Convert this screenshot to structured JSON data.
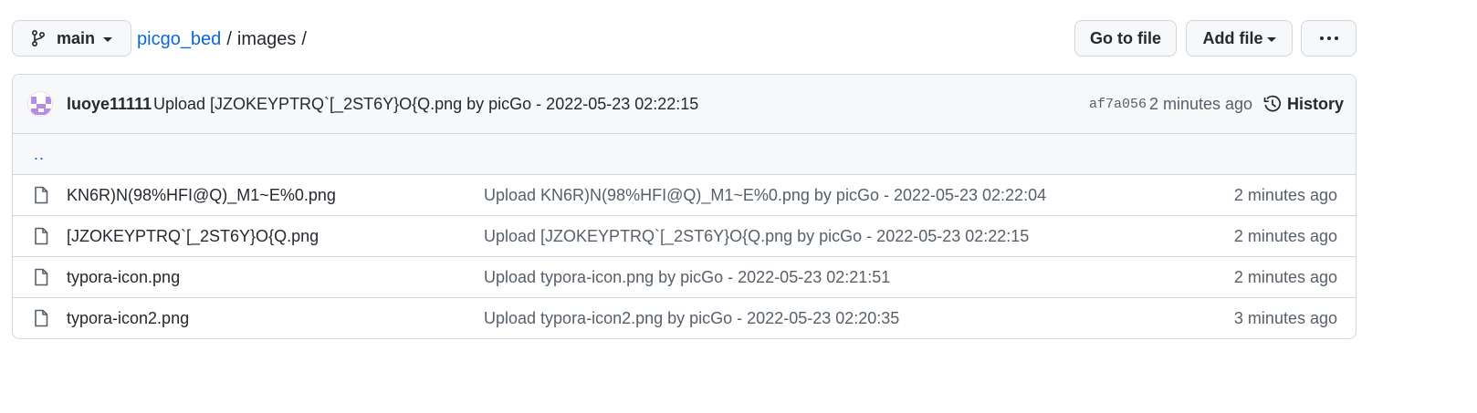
{
  "branch": {
    "name": "main"
  },
  "breadcrumb": {
    "repo": "picgo_bed",
    "sep1": "/",
    "dir": "images",
    "sep2": "/"
  },
  "actions": {
    "goto_label": "Go to file",
    "add_label": "Add file"
  },
  "commit": {
    "author": "luoye11111",
    "message": "Upload [JZOKEYPTRQ`[_2ST6Y}O{Q.png by picGo - 2022-05-23 02:22:15",
    "sha": "af7a056",
    "time": "2 minutes ago",
    "history_label": "History"
  },
  "parent_link": "..",
  "files": [
    {
      "name": "KN6R)N(98%HFI@Q)_M1~E%0.png",
      "message": "Upload KN6R)N(98%HFI@Q)_M1~E%0.png by picGo - 2022-05-23 02:22:04",
      "age": "2 minutes ago"
    },
    {
      "name": "[JZOKEYPTRQ`[_2ST6Y}O{Q.png",
      "message": "Upload [JZOKEYPTRQ`[_2ST6Y}O{Q.png by picGo - 2022-05-23 02:22:15",
      "age": "2 minutes ago"
    },
    {
      "name": "typora-icon.png",
      "message": "Upload typora-icon.png by picGo - 2022-05-23 02:21:51",
      "age": "2 minutes ago"
    },
    {
      "name": "typora-icon2.png",
      "message": "Upload typora-icon2.png by picGo - 2022-05-23 02:20:35",
      "age": "3 minutes ago"
    }
  ],
  "colors": {
    "link": "#0969da",
    "muted": "#57606a",
    "border": "#d0d7de",
    "subtle_bg": "#f6f8fa",
    "avatar": "#b78be0"
  }
}
